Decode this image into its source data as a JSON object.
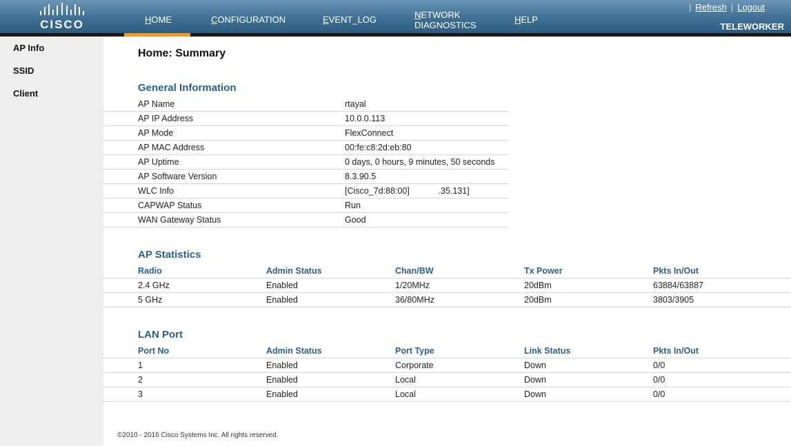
{
  "header": {
    "logo_text": "CISCO",
    "nav": [
      {
        "first": "H",
        "rest": "OME"
      },
      {
        "first": "C",
        "rest": "ONFIGURATION"
      },
      {
        "first": "E",
        "rest": "VENT_LOG"
      },
      {
        "first": "N",
        "rest": "ETWORK",
        "line2": "DIAGNOSTICS"
      },
      {
        "first": "H",
        "rest": "ELP"
      }
    ],
    "refresh_label": "Refresh",
    "logout_label": "Logout",
    "separator": "|",
    "mode_label": "TELEWORKER",
    "accent_color": "#f29a1f"
  },
  "sidebar": {
    "items": [
      {
        "label": "AP Info"
      },
      {
        "label": "SSID"
      },
      {
        "label": "Client"
      }
    ]
  },
  "main": {
    "title": "Home: Summary",
    "general": {
      "title": "General Information",
      "rows": [
        {
          "key": "AP Name",
          "value": "rtayal"
        },
        {
          "key": "AP IP Address",
          "value": "10.0.0.113"
        },
        {
          "key": "AP Mode",
          "value": "FlexConnect"
        },
        {
          "key": "AP MAC Address",
          "value": "00:fe:c8:2d:eb:80"
        },
        {
          "key": "AP Uptime",
          "value": "0 days, 0 hours, 9 minutes, 50 seconds"
        },
        {
          "key": "AP Software Version",
          "value": "8.3.90.5"
        },
        {
          "key": "WLC Info",
          "value": "[Cisco_7d:88:00]            .35.131]"
        },
        {
          "key": "CAPWAP Status",
          "value": "Run"
        },
        {
          "key": "WAN Gateway Status",
          "value": "Good"
        }
      ]
    },
    "ap_stats": {
      "title": "AP Statistics",
      "headers": [
        "Radio",
        "Admin Status",
        "Chan/BW",
        "Tx Power",
        "Pkts In/Out"
      ],
      "rows": [
        [
          "2.4 GHz",
          "Enabled",
          "1/20MHz",
          "20dBm",
          "63884/63887"
        ],
        [
          "5 GHz",
          "Enabled",
          "36/80MHz",
          "20dBm",
          "3803/3905"
        ]
      ]
    },
    "lan_port": {
      "title": "LAN Port",
      "headers": [
        "Port No",
        "Admin Status",
        "Port Type",
        "Link Status",
        "Pkts In/Out"
      ],
      "rows": [
        [
          "1",
          "Enabled",
          "Corporate",
          "Down",
          "0/0"
        ],
        [
          "2",
          "Enabled",
          "Local",
          "Down",
          "0/0"
        ],
        [
          "3",
          "Enabled",
          "Local",
          "Down",
          "0/0"
        ]
      ]
    }
  },
  "footer": {
    "copyright": "©2010 - 2016 Cisco Systems Inc. All rights reserved."
  }
}
